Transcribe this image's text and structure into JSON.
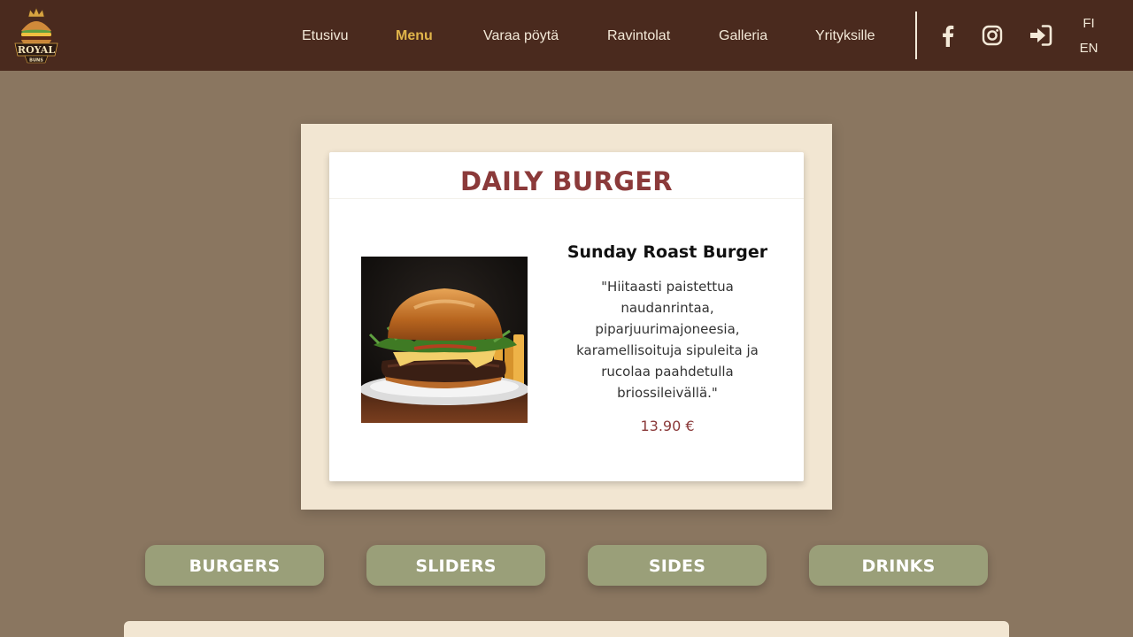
{
  "brand": {
    "logo_top": "ROYAL",
    "logo_bottom": "BUNS"
  },
  "nav": {
    "items": [
      {
        "label": "Etusivu"
      },
      {
        "label": "Menu"
      },
      {
        "label": "Varaa pöytä"
      },
      {
        "label": "Ravintolat"
      },
      {
        "label": "Galleria"
      },
      {
        "label": "Yrityksille"
      }
    ],
    "active": "Menu"
  },
  "header_icons": [
    "facebook-icon",
    "instagram-icon",
    "login-icon"
  ],
  "languages": {
    "fi": "FI",
    "en": "EN"
  },
  "daily": {
    "heading": "DAILY BURGER",
    "name": "Sunday Roast Burger",
    "description": "\"Hiitaasti paistettua naudanrintaa, piparjuurimajoneesia, karamellisoituja sipuleita ja rucolaa paahdetulla briossileivällä.\"",
    "price": "13.90 €"
  },
  "categories": [
    {
      "label": "BURGERS"
    },
    {
      "label": "SLIDERS"
    },
    {
      "label": "SIDES"
    },
    {
      "label": "DRINKS"
    }
  ],
  "colors": {
    "header_bg": "#4a2a1e",
    "page_bg": "#8a7660",
    "accent": "#e0b44a",
    "title_red": "#8b3a3a",
    "card_cream": "#f2e6d2",
    "button_green": "#9a9f79"
  }
}
